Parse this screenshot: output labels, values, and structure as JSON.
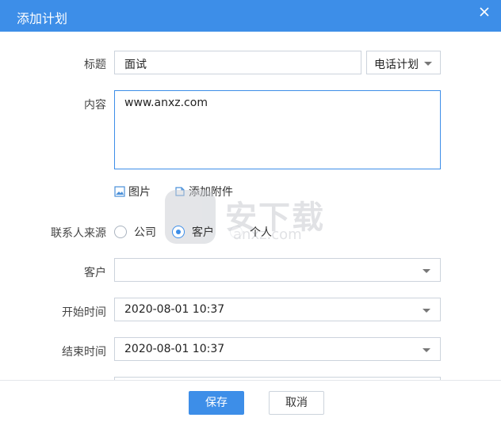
{
  "dialog": {
    "title": "添加计划"
  },
  "form": {
    "title_label": "标题",
    "title_value": "面试",
    "type_value": "电话计划",
    "content_label": "内容",
    "content_value": "www.anxz.com",
    "image_label": "图片",
    "attachment_label": "添加附件",
    "source_label": "联系人来源",
    "source_options": [
      "公司",
      "客户",
      "个人"
    ],
    "source_selected": "客户",
    "customer_label": "客户",
    "customer_value": "",
    "start_label": "开始时间",
    "start_value": "2020-08-01 10:37",
    "end_label": "结束时间",
    "end_value": "2020-08-01 10:37"
  },
  "watermark": {
    "text": "安下载",
    "sub": "anxz.com"
  },
  "footer": {
    "save_label": "保存",
    "cancel_label": "取消"
  },
  "colors": {
    "accent": "#3d8ee8",
    "border": "#ccd3dc"
  },
  "icons": {
    "close": "close-icon",
    "image": "image-icon",
    "attach": "attachment-icon",
    "dropdown": "chevron-down-icon"
  }
}
